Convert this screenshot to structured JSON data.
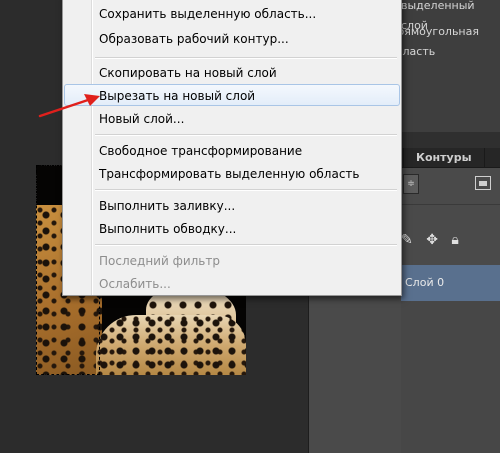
{
  "context_menu": {
    "items": [
      {
        "label": "Сохранить выделенную область...",
        "enabled": true
      },
      {
        "label": "Образовать рабочий контур...",
        "enabled": true
      },
      {
        "label": "Скопировать на новый слой",
        "enabled": true
      },
      {
        "label": "Вырезать на новый слой",
        "enabled": true,
        "highlighted": true
      },
      {
        "label": "Новый слой...",
        "enabled": true
      },
      {
        "label": "Свободное трансформирование",
        "enabled": true
      },
      {
        "label": "Трансформировать выделенную область",
        "enabled": true
      },
      {
        "label": "Выполнить заливку...",
        "enabled": true
      },
      {
        "label": "Выполнить обводку...",
        "enabled": true
      },
      {
        "label": "Последний фильтр",
        "enabled": false
      },
      {
        "label": "Ослабить...",
        "enabled": false
      }
    ]
  },
  "right_panel": {
    "top_rows": [
      "выделенный слой",
      "Прямоугольная область"
    ],
    "tabs": {
      "contours": "Контуры"
    },
    "kind_select": "≑",
    "layer_name": "Слой 0",
    "lock_icons": [
      "brush-lock-icon",
      "move-lock-icon",
      "lock-icon"
    ]
  },
  "annotation": {
    "arrow_color": "#e0201c"
  },
  "colors": {
    "menu_bg": "#f0f0f0",
    "menu_hover": "#e3edf9",
    "selected_layer": "#59708e",
    "workspace": "#2c2c2c"
  }
}
